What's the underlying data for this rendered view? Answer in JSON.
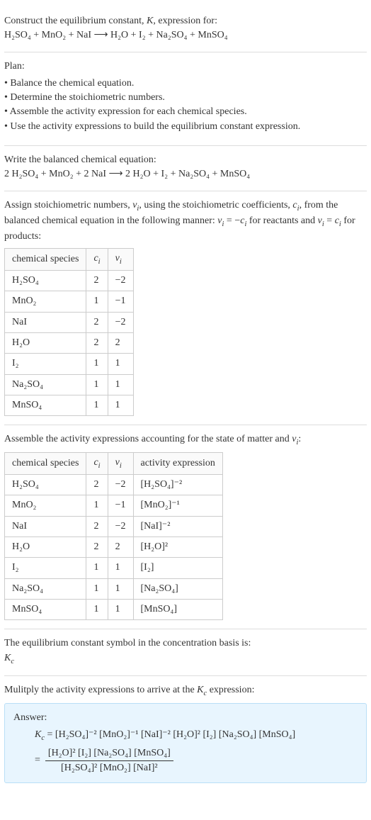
{
  "intro": {
    "line1": "Construct the equilibrium constant, K, expression for:",
    "equation": "H₂SO₄ + MnO₂ + NaI  ⟶  H₂O + I₂ + Na₂SO₄ + MnSO₄"
  },
  "plan": {
    "title": "Plan:",
    "items": [
      "Balance the chemical equation.",
      "Determine the stoichiometric numbers.",
      "Assemble the activity expression for each chemical species.",
      "Use the activity expressions to build the equilibrium constant expression."
    ]
  },
  "balanced": {
    "title": "Write the balanced chemical equation:",
    "equation": "2 H₂SO₄ + MnO₂ + 2 NaI  ⟶  2 H₂O + I₂ + Na₂SO₄ + MnSO₄"
  },
  "stoich": {
    "intro": "Assign stoichiometric numbers, νᵢ, using the stoichiometric coefficients, cᵢ, from the balanced chemical equation in the following manner: νᵢ = −cᵢ for reactants and νᵢ = cᵢ for products:",
    "headers": [
      "chemical species",
      "cᵢ",
      "νᵢ"
    ],
    "rows": [
      [
        "H₂SO₄",
        "2",
        "−2"
      ],
      [
        "MnO₂",
        "1",
        "−1"
      ],
      [
        "NaI",
        "2",
        "−2"
      ],
      [
        "H₂O",
        "2",
        "2"
      ],
      [
        "I₂",
        "1",
        "1"
      ],
      [
        "Na₂SO₄",
        "1",
        "1"
      ],
      [
        "MnSO₄",
        "1",
        "1"
      ]
    ]
  },
  "activity": {
    "intro": "Assemble the activity expressions accounting for the state of matter and νᵢ:",
    "headers": [
      "chemical species",
      "cᵢ",
      "νᵢ",
      "activity expression"
    ],
    "rows": [
      [
        "H₂SO₄",
        "2",
        "−2",
        "[H₂SO₄]⁻²"
      ],
      [
        "MnO₂",
        "1",
        "−1",
        "[MnO₂]⁻¹"
      ],
      [
        "NaI",
        "2",
        "−2",
        "[NaI]⁻²"
      ],
      [
        "H₂O",
        "2",
        "2",
        "[H₂O]²"
      ],
      [
        "I₂",
        "1",
        "1",
        "[I₂]"
      ],
      [
        "Na₂SO₄",
        "1",
        "1",
        "[Na₂SO₄]"
      ],
      [
        "MnSO₄",
        "1",
        "1",
        "[MnSO₄]"
      ]
    ]
  },
  "kcsymbol": {
    "line1": "The equilibrium constant symbol in the concentration basis is:",
    "symbol": "K_c"
  },
  "multiply": {
    "intro": "Mulitply the activity expressions to arrive at the K_c expression:"
  },
  "answer": {
    "label": "Answer:",
    "line1_lhs": "K_c = ",
    "line1_rhs": "[H₂SO₄]⁻² [MnO₂]⁻¹ [NaI]⁻² [H₂O]² [I₂] [Na₂SO₄] [MnSO₄]",
    "frac_num": "[H₂O]² [I₂] [Na₂SO₄] [MnSO₄]",
    "frac_den": "[H₂SO₄]² [MnO₂] [NaI]²"
  }
}
